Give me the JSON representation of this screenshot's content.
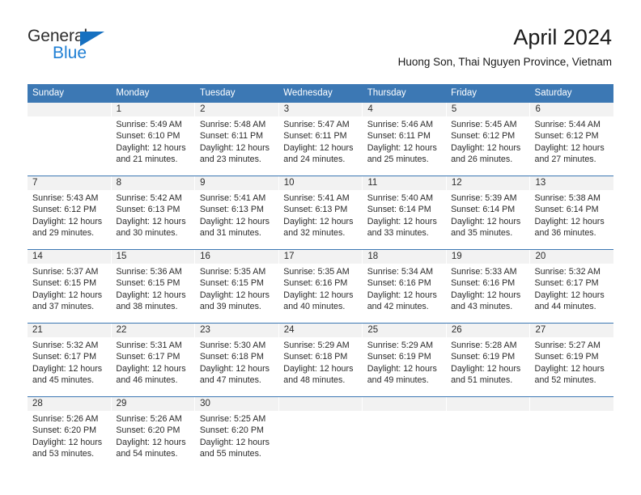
{
  "brand": {
    "name_top": "General",
    "name_bottom": "Blue",
    "accent_color": "#1f7fd4",
    "triangle_color": "#1670c0"
  },
  "header": {
    "month_title": "April 2024",
    "location": "Huong Son, Thai Nguyen Province, Vietnam"
  },
  "colors": {
    "header_bar": "#3c78b4",
    "day_band": "#f2f2f2",
    "text": "#2b2b2b"
  },
  "weekdays": [
    "Sunday",
    "Monday",
    "Tuesday",
    "Wednesday",
    "Thursday",
    "Friday",
    "Saturday"
  ],
  "weeks": [
    {
      "days": [
        {
          "num": "",
          "sunrise": "",
          "sunset": "",
          "daylight1": "",
          "daylight2": ""
        },
        {
          "num": "1",
          "sunrise": "Sunrise: 5:49 AM",
          "sunset": "Sunset: 6:10 PM",
          "daylight1": "Daylight: 12 hours",
          "daylight2": "and 21 minutes."
        },
        {
          "num": "2",
          "sunrise": "Sunrise: 5:48 AM",
          "sunset": "Sunset: 6:11 PM",
          "daylight1": "Daylight: 12 hours",
          "daylight2": "and 23 minutes."
        },
        {
          "num": "3",
          "sunrise": "Sunrise: 5:47 AM",
          "sunset": "Sunset: 6:11 PM",
          "daylight1": "Daylight: 12 hours",
          "daylight2": "and 24 minutes."
        },
        {
          "num": "4",
          "sunrise": "Sunrise: 5:46 AM",
          "sunset": "Sunset: 6:11 PM",
          "daylight1": "Daylight: 12 hours",
          "daylight2": "and 25 minutes."
        },
        {
          "num": "5",
          "sunrise": "Sunrise: 5:45 AM",
          "sunset": "Sunset: 6:12 PM",
          "daylight1": "Daylight: 12 hours",
          "daylight2": "and 26 minutes."
        },
        {
          "num": "6",
          "sunrise": "Sunrise: 5:44 AM",
          "sunset": "Sunset: 6:12 PM",
          "daylight1": "Daylight: 12 hours",
          "daylight2": "and 27 minutes."
        }
      ]
    },
    {
      "days": [
        {
          "num": "7",
          "sunrise": "Sunrise: 5:43 AM",
          "sunset": "Sunset: 6:12 PM",
          "daylight1": "Daylight: 12 hours",
          "daylight2": "and 29 minutes."
        },
        {
          "num": "8",
          "sunrise": "Sunrise: 5:42 AM",
          "sunset": "Sunset: 6:13 PM",
          "daylight1": "Daylight: 12 hours",
          "daylight2": "and 30 minutes."
        },
        {
          "num": "9",
          "sunrise": "Sunrise: 5:41 AM",
          "sunset": "Sunset: 6:13 PM",
          "daylight1": "Daylight: 12 hours",
          "daylight2": "and 31 minutes."
        },
        {
          "num": "10",
          "sunrise": "Sunrise: 5:41 AM",
          "sunset": "Sunset: 6:13 PM",
          "daylight1": "Daylight: 12 hours",
          "daylight2": "and 32 minutes."
        },
        {
          "num": "11",
          "sunrise": "Sunrise: 5:40 AM",
          "sunset": "Sunset: 6:14 PM",
          "daylight1": "Daylight: 12 hours",
          "daylight2": "and 33 minutes."
        },
        {
          "num": "12",
          "sunrise": "Sunrise: 5:39 AM",
          "sunset": "Sunset: 6:14 PM",
          "daylight1": "Daylight: 12 hours",
          "daylight2": "and 35 minutes."
        },
        {
          "num": "13",
          "sunrise": "Sunrise: 5:38 AM",
          "sunset": "Sunset: 6:14 PM",
          "daylight1": "Daylight: 12 hours",
          "daylight2": "and 36 minutes."
        }
      ]
    },
    {
      "days": [
        {
          "num": "14",
          "sunrise": "Sunrise: 5:37 AM",
          "sunset": "Sunset: 6:15 PM",
          "daylight1": "Daylight: 12 hours",
          "daylight2": "and 37 minutes."
        },
        {
          "num": "15",
          "sunrise": "Sunrise: 5:36 AM",
          "sunset": "Sunset: 6:15 PM",
          "daylight1": "Daylight: 12 hours",
          "daylight2": "and 38 minutes."
        },
        {
          "num": "16",
          "sunrise": "Sunrise: 5:35 AM",
          "sunset": "Sunset: 6:15 PM",
          "daylight1": "Daylight: 12 hours",
          "daylight2": "and 39 minutes."
        },
        {
          "num": "17",
          "sunrise": "Sunrise: 5:35 AM",
          "sunset": "Sunset: 6:16 PM",
          "daylight1": "Daylight: 12 hours",
          "daylight2": "and 40 minutes."
        },
        {
          "num": "18",
          "sunrise": "Sunrise: 5:34 AM",
          "sunset": "Sunset: 6:16 PM",
          "daylight1": "Daylight: 12 hours",
          "daylight2": "and 42 minutes."
        },
        {
          "num": "19",
          "sunrise": "Sunrise: 5:33 AM",
          "sunset": "Sunset: 6:16 PM",
          "daylight1": "Daylight: 12 hours",
          "daylight2": "and 43 minutes."
        },
        {
          "num": "20",
          "sunrise": "Sunrise: 5:32 AM",
          "sunset": "Sunset: 6:17 PM",
          "daylight1": "Daylight: 12 hours",
          "daylight2": "and 44 minutes."
        }
      ]
    },
    {
      "days": [
        {
          "num": "21",
          "sunrise": "Sunrise: 5:32 AM",
          "sunset": "Sunset: 6:17 PM",
          "daylight1": "Daylight: 12 hours",
          "daylight2": "and 45 minutes."
        },
        {
          "num": "22",
          "sunrise": "Sunrise: 5:31 AM",
          "sunset": "Sunset: 6:17 PM",
          "daylight1": "Daylight: 12 hours",
          "daylight2": "and 46 minutes."
        },
        {
          "num": "23",
          "sunrise": "Sunrise: 5:30 AM",
          "sunset": "Sunset: 6:18 PM",
          "daylight1": "Daylight: 12 hours",
          "daylight2": "and 47 minutes."
        },
        {
          "num": "24",
          "sunrise": "Sunrise: 5:29 AM",
          "sunset": "Sunset: 6:18 PM",
          "daylight1": "Daylight: 12 hours",
          "daylight2": "and 48 minutes."
        },
        {
          "num": "25",
          "sunrise": "Sunrise: 5:29 AM",
          "sunset": "Sunset: 6:19 PM",
          "daylight1": "Daylight: 12 hours",
          "daylight2": "and 49 minutes."
        },
        {
          "num": "26",
          "sunrise": "Sunrise: 5:28 AM",
          "sunset": "Sunset: 6:19 PM",
          "daylight1": "Daylight: 12 hours",
          "daylight2": "and 51 minutes."
        },
        {
          "num": "27",
          "sunrise": "Sunrise: 5:27 AM",
          "sunset": "Sunset: 6:19 PM",
          "daylight1": "Daylight: 12 hours",
          "daylight2": "and 52 minutes."
        }
      ]
    },
    {
      "days": [
        {
          "num": "28",
          "sunrise": "Sunrise: 5:26 AM",
          "sunset": "Sunset: 6:20 PM",
          "daylight1": "Daylight: 12 hours",
          "daylight2": "and 53 minutes."
        },
        {
          "num": "29",
          "sunrise": "Sunrise: 5:26 AM",
          "sunset": "Sunset: 6:20 PM",
          "daylight1": "Daylight: 12 hours",
          "daylight2": "and 54 minutes."
        },
        {
          "num": "30",
          "sunrise": "Sunrise: 5:25 AM",
          "sunset": "Sunset: 6:20 PM",
          "daylight1": "Daylight: 12 hours",
          "daylight2": "and 55 minutes."
        },
        {
          "num": "",
          "sunrise": "",
          "sunset": "",
          "daylight1": "",
          "daylight2": ""
        },
        {
          "num": "",
          "sunrise": "",
          "sunset": "",
          "daylight1": "",
          "daylight2": ""
        },
        {
          "num": "",
          "sunrise": "",
          "sunset": "",
          "daylight1": "",
          "daylight2": ""
        },
        {
          "num": "",
          "sunrise": "",
          "sunset": "",
          "daylight1": "",
          "daylight2": ""
        }
      ]
    }
  ]
}
